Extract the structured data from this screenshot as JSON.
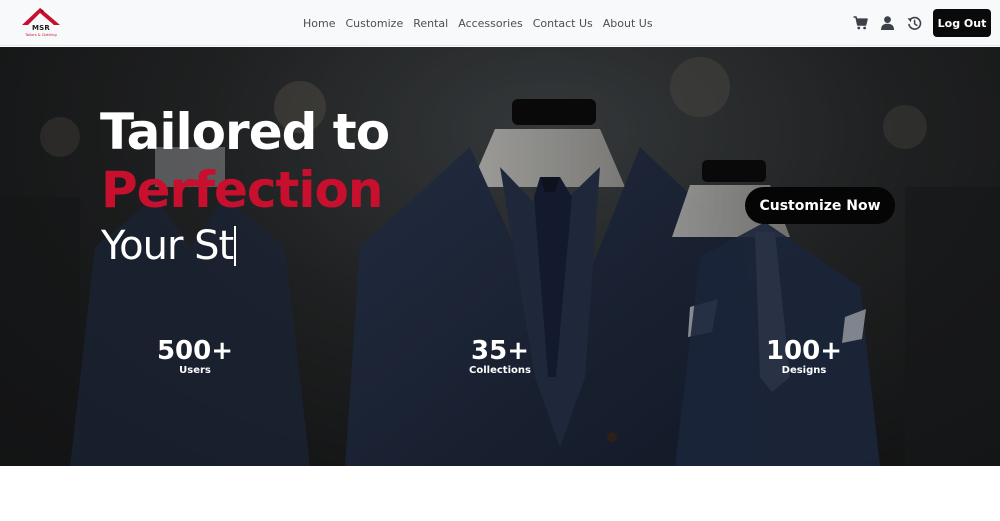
{
  "header": {
    "logo": {
      "brand": "MSR",
      "tagline": "Tailors & Clothing"
    },
    "nav": [
      {
        "label": "Home"
      },
      {
        "label": "Customize"
      },
      {
        "label": "Rental"
      },
      {
        "label": "Accessories"
      },
      {
        "label": "Contact Us"
      },
      {
        "label": "About Us"
      }
    ],
    "icons": [
      "cart-icon",
      "user-icon",
      "history-icon"
    ],
    "logout_label": "Log Out"
  },
  "hero": {
    "headline_line1": "Tailored to",
    "headline_line2": "Perfection",
    "typing_text": "Your St",
    "cta_label": "Customize Now",
    "stats": [
      {
        "value": "500+",
        "label": "Users"
      },
      {
        "value": "35+",
        "label": "Collections"
      },
      {
        "value": "100+",
        "label": "Designs"
      }
    ]
  },
  "colors": {
    "accent_red": "#c8102e",
    "button_black": "#0a0a0a",
    "navbar_bg": "#f8f9fb",
    "suit_navy": "#24324a"
  }
}
